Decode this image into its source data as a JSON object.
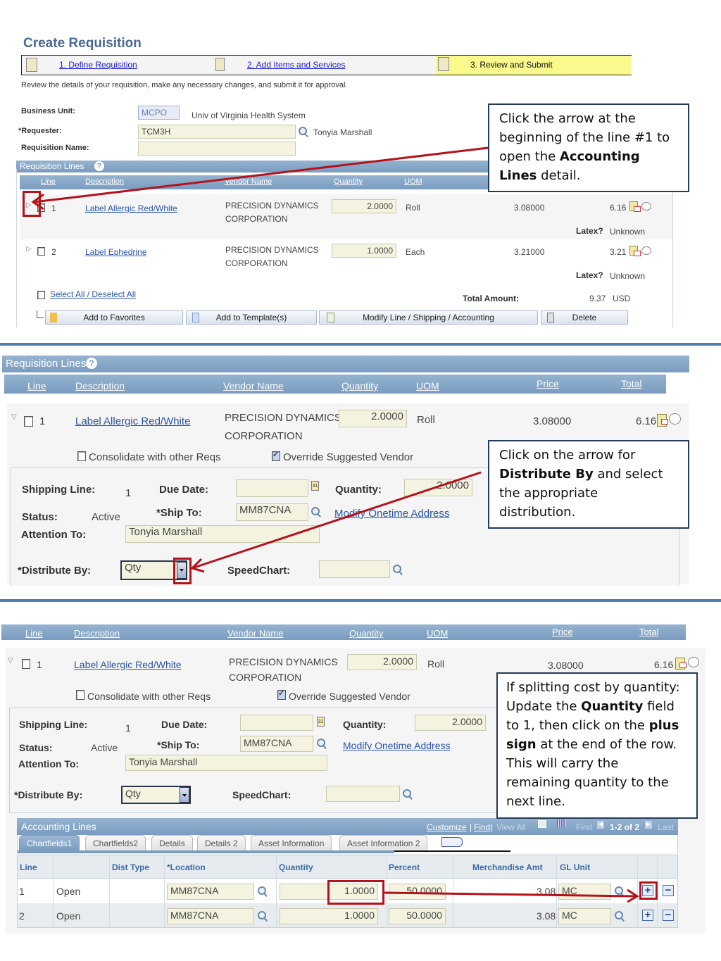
{
  "panel1": {
    "page_title": "Create Requisition",
    "steps": [
      {
        "label": "1. Define Requisition",
        "icon": "define-requisition-icon"
      },
      {
        "label": "2. Add Items and Services",
        "icon": "add-items-icon"
      },
      {
        "label": "3. Review and Submit",
        "icon": "review-submit-icon",
        "active": true
      }
    ],
    "instructions": "Review the details of your requisition, make any necessary changes, and submit it for approval.",
    "business_unit_label": "Business Unit:",
    "business_unit_value": "MCPO",
    "business_unit_desc": "Univ of Virginia Health System",
    "requester_label": "*Requester:",
    "requester_value": "TCM3H",
    "requester_name": "Tonyia Marshall",
    "req_name_label": "Requisition Name:",
    "req_name_value": "",
    "section_title": "Requisition Lines",
    "columns": [
      "Line",
      "Description",
      "Vendor Name",
      "Quantity",
      "UOM"
    ],
    "lines": [
      {
        "line": "1",
        "description": "Label Allergic Red/White",
        "vendor_1": "PRECISION DYNAMICS",
        "vendor_2": "CORPORATION",
        "quantity": "2.0000",
        "uom": "Roll",
        "price": "3.08000",
        "total": "6.16",
        "latex_label": "Latex?",
        "latex_value": "Unknown"
      },
      {
        "line": "2",
        "description": "Label Ephedrine",
        "vendor_1": "PRECISION DYNAMICS",
        "vendor_2": "CORPORATION",
        "quantity": "1.0000",
        "uom": "Each",
        "price": "3.21000",
        "total": "3.21",
        "latex_label": "Latex?",
        "latex_value": "Unknown"
      }
    ],
    "select_all": "Select All / Deselect All",
    "total_amount_label": "Total Amount:",
    "total_amount_value": "9.37",
    "currency": "USD",
    "buttons": {
      "add_favorites": "Add to Favorites",
      "add_template": "Add to Template(s)",
      "modify_line": "Modify Line / Shipping / Accounting",
      "delete": "Delete"
    },
    "callout": {
      "pre": "Click the arrow at the beginning of the line #1 to open the ",
      "bold": "Accounting Lines",
      "post": " detail."
    }
  },
  "panel2": {
    "section_title": "Requisition Lines",
    "columns": [
      "Line",
      "Description",
      "Vendor Name",
      "Quantity",
      "UOM",
      "Price",
      "Total"
    ],
    "line": {
      "line": "1",
      "description": "Label Allergic Red/White",
      "vendor_1": "PRECISION DYNAMICS",
      "vendor_2": "CORPORATION",
      "quantity": "2.0000",
      "uom": "Roll",
      "price": "3.08000",
      "total": "6.16"
    },
    "consolidate_label": "Consolidate with other Reqs",
    "consolidate_checked": false,
    "override_label": "Override Suggested Vendor",
    "override_checked": true,
    "shipping_line_label": "Shipping Line:",
    "shipping_line_value": "1",
    "due_date_label": "Due Date:",
    "due_date_value": "",
    "quantity_label": "Quantity:",
    "quantity_value": "2.0000",
    "status_label": "Status:",
    "status_value": "Active",
    "ship_to_label": "*Ship To:",
    "ship_to_value": "MM87CNA",
    "modify_address": "Modify Onetime Address",
    "attention_label": "Attention To:",
    "attention_value": "Tonyia Marshall",
    "distribute_label": "*Distribute By:",
    "distribute_value": "Qty",
    "speedchart_label": "SpeedChart:",
    "speedchart_value": "",
    "callout": {
      "pre": "Click on the arrow  for ",
      "bold": "Distribute By",
      "post": " and select the appropriate distribution."
    }
  },
  "panel3": {
    "columns": [
      "Line",
      "Description",
      "Vendor Name",
      "Quantity",
      "UOM",
      "Price",
      "Total"
    ],
    "line": {
      "line": "1",
      "description": "Label Allergic Red/White",
      "vendor_1": "PRECISION DYNAMICS",
      "vendor_2": "CORPORATION",
      "quantity": "2.0000",
      "uom": "Roll",
      "price": "3.08000",
      "total": "6.16"
    },
    "consolidate_label": "Consolidate with other Reqs",
    "override_label": "Override Suggested Vendor",
    "shipping_line_label": "Shipping Line:",
    "shipping_line_value": "1",
    "due_date_label": "Due Date:",
    "quantity_label": "Quantity:",
    "quantity_value": "2.0000",
    "status_label": "Status:",
    "status_value": "Active",
    "ship_to_label": "*Ship To:",
    "ship_to_value": "MM87CNA",
    "modify_address": "Modify Onetime Address",
    "attention_label": "Attention To:",
    "attention_value": "Tonyia Marshall",
    "distribute_label": "*Distribute By:",
    "distribute_value": "Qty",
    "speedchart_label": "SpeedChart:",
    "accounting": {
      "title": "Accounting Lines",
      "nav": {
        "customize": "Customize",
        "find": "Find",
        "view_all": "View All",
        "first": "First",
        "range": "1-2 of 2",
        "last": "Last"
      },
      "tabs": [
        "Chartfields1",
        "Chartfields2",
        "Details",
        "Details 2",
        "Asset Information",
        "Asset Information 2"
      ],
      "columns": [
        "Line",
        "",
        "Dist Type",
        "*Location",
        "Quantity",
        "Percent",
        "Merchandise Amt",
        "GL Unit"
      ],
      "rows": [
        {
          "line": "1",
          "status": "Open",
          "dist_type": "",
          "location": "MM87CNA",
          "quantity": "1.0000",
          "percent": "50.0000",
          "merch_amt": "3.08",
          "gl_unit": "MC"
        },
        {
          "line": "2",
          "status": "Open",
          "dist_type": "",
          "location": "MM87CNA",
          "quantity": "1.0000",
          "percent": "50.0000",
          "merch_amt": "3.08",
          "gl_unit": "MC"
        }
      ]
    },
    "callout": {
      "l1": "If splitting cost by quantity:",
      "l2_pre": "Update the ",
      "l2_bold": "Quantity",
      "l2_post": " field",
      "l3_pre": "to 1, then click on the ",
      "l3_bold": "plus",
      "l4_bold": "sign",
      "l4_post": " at the end of the row.",
      "l5": "This will carry the",
      "l6": "remaining quantity to the",
      "l7": "next line."
    }
  },
  "colors": {
    "accent": "#4f7fb8",
    "annotation_red": "#b4121b",
    "header_blue": "#7a9cc0",
    "field_bg": "#f3f3df",
    "step_active": "#fafa8c"
  }
}
